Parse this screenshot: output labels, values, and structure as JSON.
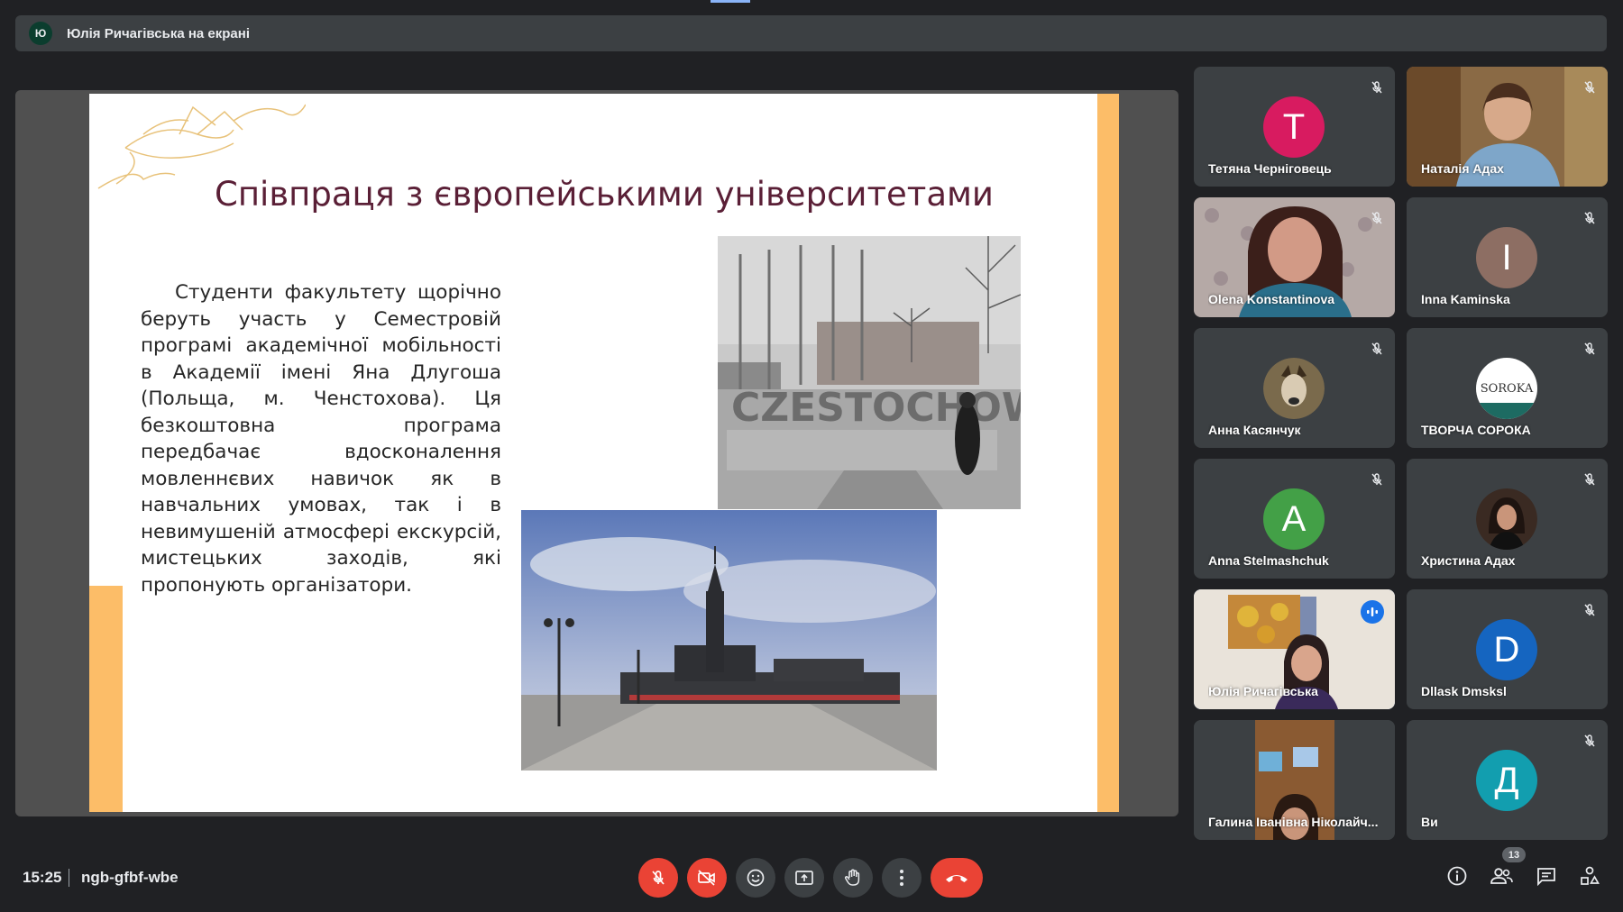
{
  "presenter_bar": {
    "avatar_letter": "Ю",
    "title": "Юлія Ричагівська на екрані"
  },
  "slide": {
    "title": "Співпраця з європейськими університетами",
    "body": "Студенти факультету щорічно беруть участь у Семестровій програмі академічної мобільності в Академії імені Яна Длугоша (Польща, м. Ченстохова). Ця безкоштовна програма передбачає вдосконалення мовленнєвих навичок як в навчальних умовах, так і в невимушеній атмосфері екскурсій, мистецьких заходів, які пропонують організатори.",
    "photo1_sign": "CZESTOCHOWA",
    "accent_color": "#fcbd68",
    "title_color": "#5a1f36"
  },
  "participants": [
    {
      "name": "Тетяна Черніговець",
      "letter": "T",
      "color": "#d81b60",
      "muted": true
    },
    {
      "name": "Наталія Адах",
      "video": true,
      "muted": true
    },
    {
      "name": "Olena Konstantinova",
      "video": true,
      "muted": true
    },
    {
      "name": "Inna Kaminska",
      "letter": "I",
      "color": "#8d6e63",
      "muted": true
    },
    {
      "name": "Анна Касянчук",
      "avatar_image": "dog-photo",
      "muted": true
    },
    {
      "name": "ТВОРЧА СОРОКА",
      "avatar_image": "soroka-logo",
      "logo_text": "SOROKA",
      "muted": true
    },
    {
      "name": "Anna Stelmashchuk",
      "letter": "A",
      "color": "#43a047",
      "muted": true
    },
    {
      "name": "Христина Адах",
      "avatar_image": "portrait-photo",
      "muted": true
    },
    {
      "name": "Юлія Ричагівська",
      "video": true,
      "speaking": true
    },
    {
      "name": "Dllask Dmsksl",
      "letter": "D",
      "color": "#1565c0",
      "muted": true
    },
    {
      "name": "Галина Іванівна Ніколайч...",
      "video": true
    },
    {
      "name": "Ви",
      "letter": "Д",
      "color": "#129eaf",
      "muted": true
    }
  ],
  "bottom_bar": {
    "time": "15:25",
    "meeting_code": "ngb-gfbf-wbe",
    "people_count": "13",
    "icons": [
      "mic-off-icon",
      "camera-off-icon",
      "emoji-icon",
      "present-screen-icon",
      "raise-hand-icon",
      "more-options-icon",
      "end-call-icon",
      "info-icon",
      "people-icon",
      "chat-icon",
      "activities-icon"
    ]
  }
}
